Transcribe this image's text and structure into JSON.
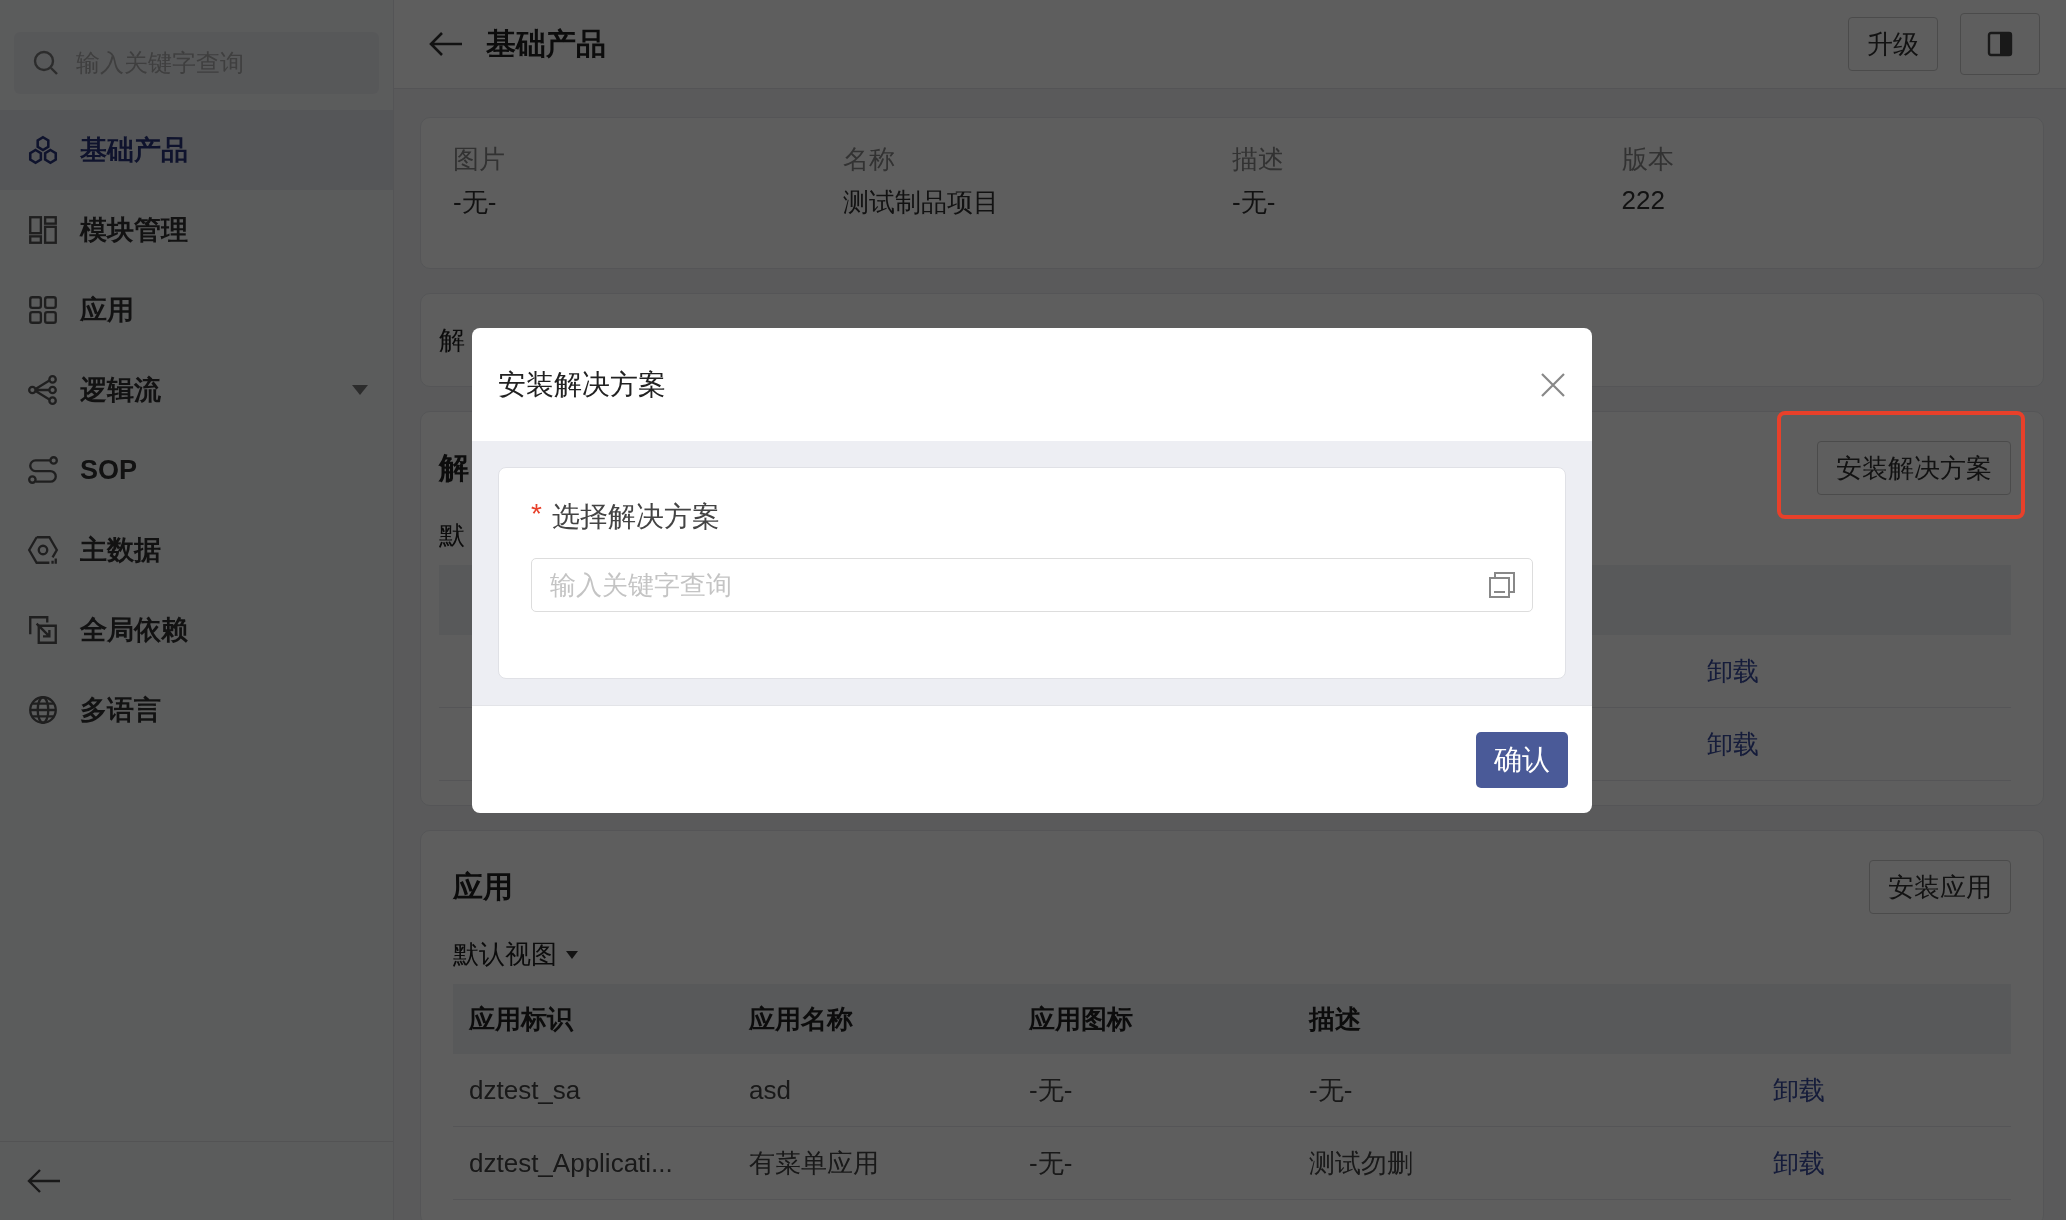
{
  "sidebar": {
    "search": {
      "placeholder": "输入关键字查询"
    },
    "items": [
      {
        "label": "基础产品",
        "selected": true,
        "has_submenu": false
      },
      {
        "label": "模块管理",
        "selected": false,
        "has_submenu": false
      },
      {
        "label": "应用",
        "selected": false,
        "has_submenu": false
      },
      {
        "label": "逻辑流",
        "selected": false,
        "has_submenu": true
      },
      {
        "label": "SOP",
        "selected": false,
        "has_submenu": false
      },
      {
        "label": "主数据",
        "selected": false,
        "has_submenu": false
      },
      {
        "label": "全局依赖",
        "selected": false,
        "has_submenu": false
      },
      {
        "label": "多语言",
        "selected": false,
        "has_submenu": false
      }
    ]
  },
  "header": {
    "title": "基础产品",
    "buttons": [
      "升级"
    ]
  },
  "info_card": {
    "fields": [
      {
        "label": "图片",
        "value": "-无-"
      },
      {
        "label": "名称",
        "value": "测试制品项目"
      },
      {
        "label": "描述",
        "value": "-无-"
      },
      {
        "label": "版本",
        "value": "222"
      }
    ]
  },
  "notice_card": {
    "text": "解"
  },
  "solutions": {
    "title": "解",
    "install_button": {
      "label": "安装解决方案",
      "highlighted": true
    },
    "view": "默",
    "rows": [
      {
        "action": "卸载"
      },
      {
        "action": "卸载"
      }
    ]
  },
  "apps": {
    "title": "应用",
    "install_button": "安装应用",
    "view": "默认视图",
    "columns": [
      "应用标识",
      "应用名称",
      "应用图标",
      "描述"
    ],
    "rows": [
      {
        "cells": [
          "dztest_sa",
          "asd",
          "-无-",
          "-无-"
        ],
        "action": "卸载"
      },
      {
        "cells": [
          "dztest_Applicati...",
          "有菜单应用",
          "-无-",
          "测试勿删"
        ],
        "action": "卸载"
      }
    ]
  },
  "dialog": {
    "title": "安装解决方案",
    "field": {
      "label": "选择解决方案",
      "required_mark": "*",
      "placeholder": "输入关键字查询"
    },
    "confirm": "确认"
  }
}
